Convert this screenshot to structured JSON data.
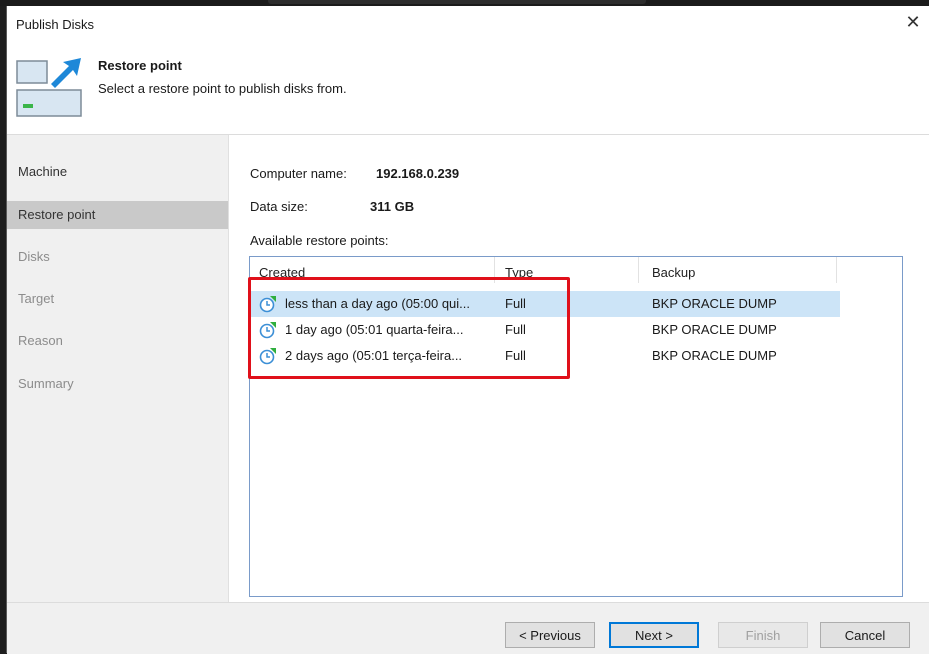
{
  "window": {
    "title": "Publish Disks",
    "close_label": "✕"
  },
  "header": {
    "title": "Restore point",
    "subtitle": "Select a restore point to publish disks from."
  },
  "sidebar": {
    "items": [
      {
        "label": "Machine",
        "state": "done"
      },
      {
        "label": "Restore point",
        "state": "active"
      },
      {
        "label": "Disks",
        "state": "disabled"
      },
      {
        "label": "Target",
        "state": "disabled"
      },
      {
        "label": "Reason",
        "state": "disabled"
      },
      {
        "label": "Summary",
        "state": "disabled"
      }
    ]
  },
  "main": {
    "computer_name_label": "Computer name:",
    "computer_name_value": "192.168.0.239",
    "data_size_label": "Data size:",
    "data_size_value": "311 GB",
    "list_label": "Available restore points:",
    "columns": [
      "Created",
      "Type",
      "Backup"
    ],
    "rows": [
      {
        "created": "less than a day ago (05:00 qui...",
        "type": "Full",
        "backup": "BKP ORACLE DUMP",
        "selected": true
      },
      {
        "created": "1 day ago (05:01 quarta-feira...",
        "type": "Full",
        "backup": "BKP ORACLE DUMP",
        "selected": false
      },
      {
        "created": "2 days ago (05:01 terça-feira...",
        "type": "Full",
        "backup": "BKP ORACLE DUMP",
        "selected": false
      }
    ]
  },
  "footer": {
    "previous_label": "< Previous",
    "next_label": "Next >",
    "finish_label": "Finish",
    "cancel_label": "Cancel"
  },
  "colors": {
    "selection": "#cce4f7",
    "highlight_box": "#e0101a",
    "accent": "#0078d7"
  },
  "icons": {
    "header": "restore-point-wizard-icon",
    "row": "restore-point-icon"
  }
}
